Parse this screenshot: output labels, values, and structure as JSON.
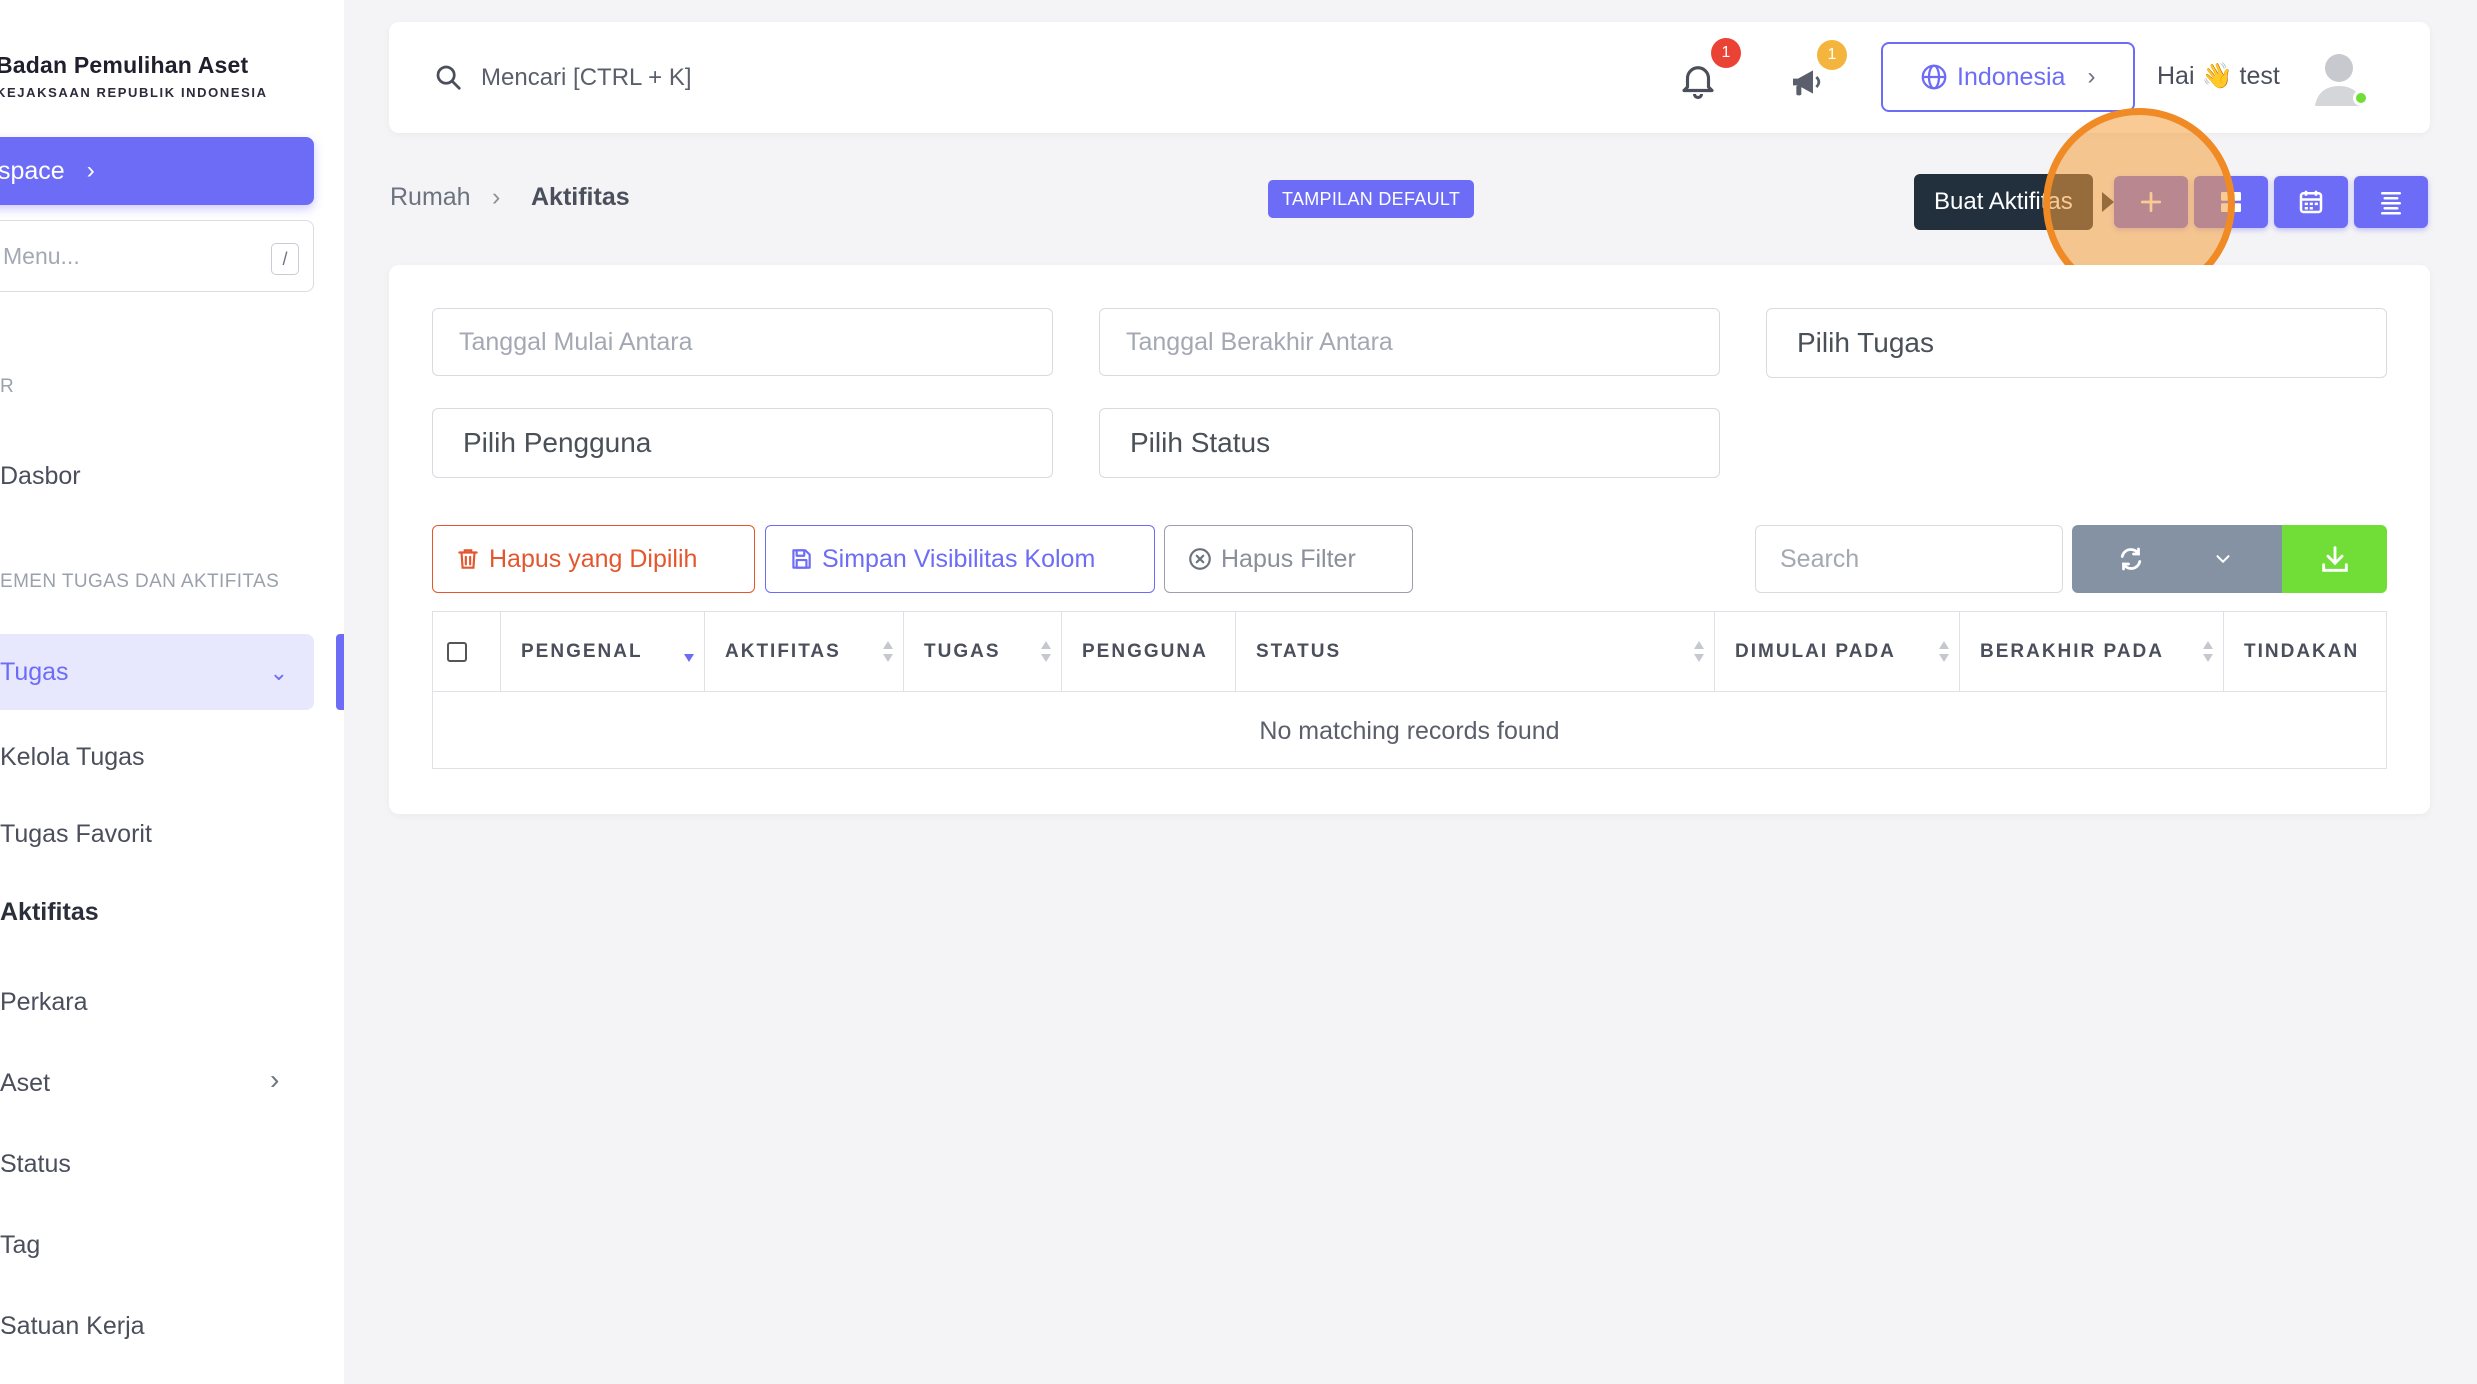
{
  "sidebar": {
    "brand_title": "Badan Pemulihan Aset",
    "brand_subtitle": "KEJAKSAAN REPUBLIK INDONESIA",
    "workspace_label": "space",
    "menu_search_placeholder": "Menu...",
    "menu_search_shortcut": "/",
    "section_1": "R",
    "section_2": "EMEN TUGAS DAN AKTIFITAS",
    "items": [
      {
        "label": "Dasbor"
      },
      {
        "label": "Tugas"
      },
      {
        "label": "Kelola Tugas"
      },
      {
        "label": "Tugas Favorit"
      },
      {
        "label": "Aktifitas"
      },
      {
        "label": "Perkara"
      },
      {
        "label": "Aset"
      },
      {
        "label": "Status"
      },
      {
        "label": "Tag"
      },
      {
        "label": "Satuan Kerja"
      }
    ]
  },
  "header": {
    "search_text": "Mencari [CTRL + K]",
    "notification_count": "1",
    "announcement_count": "1",
    "language": "Indonesia",
    "greeting": "Hai 👋 test"
  },
  "breadcrumb": {
    "home": "Rumah",
    "separator": "›",
    "current": "Aktifitas"
  },
  "view_badge": "TAMPILAN DEFAULT",
  "tooltip": "Buat Aktifitas",
  "filters": {
    "start_date_placeholder": "Tanggal Mulai Antara",
    "end_date_placeholder": "Tanggal Berakhir Antara",
    "task_select": "Pilih Tugas",
    "user_select": "Pilih Pengguna",
    "status_select": "Pilih Status"
  },
  "actions": {
    "delete_selected": "Hapus yang Dipilih",
    "save_visibility": "Simpan Visibilitas Kolom",
    "clear_filter": "Hapus Filter",
    "table_search_placeholder": "Search"
  },
  "table": {
    "columns": [
      "PENGENAL",
      "AKTIFITAS",
      "TUGAS",
      "PENGGUNA",
      "STATUS",
      "DIMULAI PADA",
      "BERAKHIR PADA",
      "TINDAKAN"
    ],
    "empty_message": "No matching records found"
  },
  "colors": {
    "primary": "#6d6cf6",
    "danger": "#e4572e",
    "success": "#71dd37",
    "secondary": "#8592a3",
    "highlight": "#f08a24"
  },
  "icons": {
    "search": "search-icon",
    "bell": "bell-icon",
    "megaphone": "megaphone-icon",
    "globe": "globe-icon",
    "plus": "plus-icon",
    "grid": "grid-icon",
    "calendar": "calendar-icon",
    "list": "list-icon",
    "trash": "trash-icon",
    "save": "save-icon",
    "clear": "x-circle-icon",
    "refresh": "refresh-icon",
    "download": "download-icon"
  }
}
